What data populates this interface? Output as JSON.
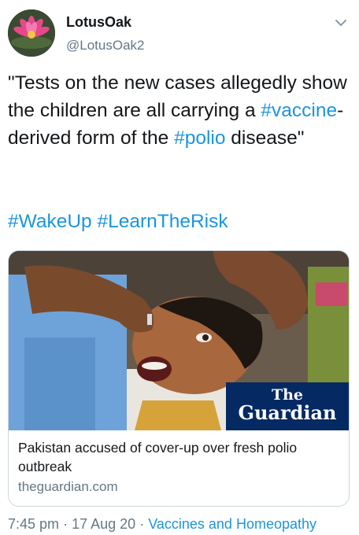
{
  "tweet": {
    "display_name": "LotusOak",
    "handle": "@LotusOak2",
    "text_before_1": "\"Tests on the new cases allegedly show the children are all carrying a ",
    "hashtag_1": "#vaccine",
    "text_after_1": "-derived form of the ",
    "hashtag_2": "#polio",
    "text_after_2": " disease\"",
    "tags": [
      "#WakeUp",
      "#LearnTheRisk"
    ]
  },
  "card": {
    "logo_the": "The",
    "logo_guardian": "Guardian",
    "title": "Pakistan accused of cover-up over fresh polio outbreak",
    "domain": "theguardian.com"
  },
  "meta": {
    "time": "7:45 pm",
    "separator": "·",
    "date": "17 Aug 20",
    "source": "Vaccines and Homeopathy"
  },
  "icons": {
    "avatar": "lotus-flower-avatar",
    "menu": "chevron-down-icon"
  },
  "colors": {
    "hashtag": "#1b95e0",
    "secondary_text": "#657786",
    "guardian_blue": "#052962"
  }
}
